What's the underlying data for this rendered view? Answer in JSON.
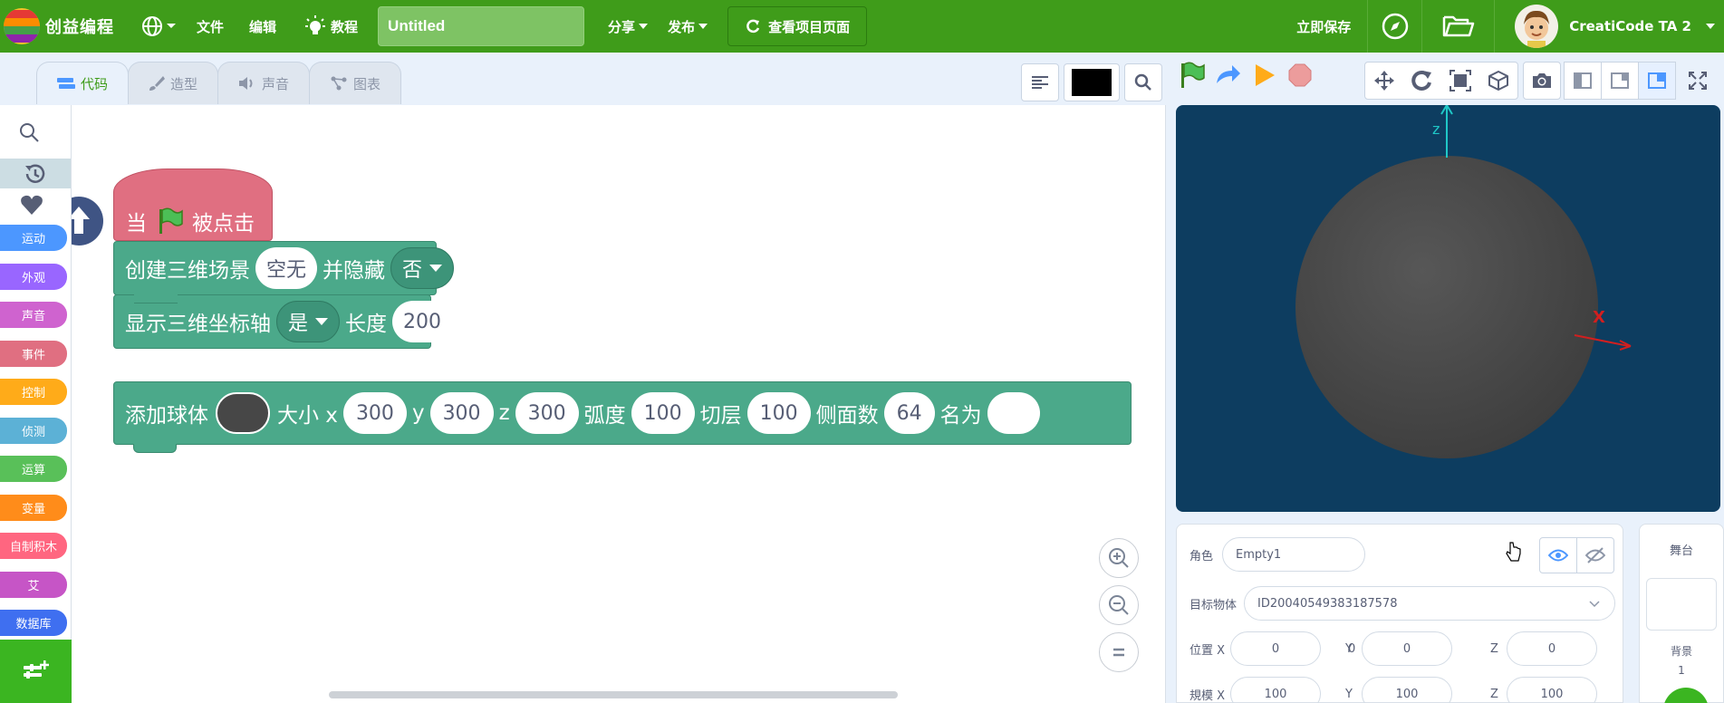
{
  "menubar": {
    "logo_text": "创益编程",
    "file": "文件",
    "edit": "编辑",
    "tutorial": "教程",
    "project_title": "Untitled",
    "share": "分享",
    "publish": "发布",
    "view_project_page": "查看项目页面",
    "save_now": "立即保存",
    "username": "CreatiCode TA 2"
  },
  "tabs": {
    "code": "代码",
    "costumes": "造型",
    "sounds": "声音",
    "charts": "图表"
  },
  "categories": [
    {
      "label": "运动",
      "color": "#4c97ff"
    },
    {
      "label": "外观",
      "color": "#9966ff"
    },
    {
      "label": "声音",
      "color": "#cf63cf"
    },
    {
      "label": "事件",
      "color": "#e06f81"
    },
    {
      "label": "控制",
      "color": "#ffab19"
    },
    {
      "label": "侦测",
      "color": "#5cb1d6"
    },
    {
      "label": "运算",
      "color": "#59c059"
    },
    {
      "label": "变量",
      "color": "#ff8c1a"
    },
    {
      "label": "自制积木",
      "color": "#ff6680"
    },
    {
      "label": "艾",
      "color": "#c655c6"
    },
    {
      "label": "数据库",
      "color": "#3f6ff0"
    }
  ],
  "blocks": {
    "hat": {
      "when": "当",
      "clicked": "被点击"
    },
    "create_scene": {
      "label": "创建三维场景",
      "scene": "空无",
      "and_hide": "并隐藏",
      "hide": "否"
    },
    "show_axis": {
      "label": "显示三维坐标轴",
      "value": "是",
      "length_label": "长度",
      "length": "200"
    },
    "add_sphere": {
      "label": "添加球体",
      "size_x_label": "大小 x",
      "x": "300",
      "y_label": "y",
      "y": "300",
      "z_label": "z",
      "z": "300",
      "arc_label": "弧度",
      "arc": "100",
      "slice_label": "切层",
      "slice": "100",
      "sides_label": "侧面数",
      "sides": "64",
      "name_label": "名为",
      "name": ""
    }
  },
  "stage": {
    "background": "#0d3d60",
    "axis_z": "z",
    "axis_x": "X",
    "sphere_color": "#474747"
  },
  "sprite_panel": {
    "sprite_label": "角色",
    "sprite_name": "Empty1",
    "target_label": "目标物体",
    "target_value": "ID20040549383187578",
    "position_x_label": "位置 X",
    "position_x": "0",
    "position_y_label": "Y",
    "position_y": "0",
    "position_z_label": "Z",
    "position_z": "0",
    "scale_x_label": "規模 X",
    "scale_x": "100",
    "scale_y_label": "Y",
    "scale_y": "100",
    "scale_z_label": "Z",
    "scale_z": "100"
  },
  "stage_panel": {
    "title": "舞台",
    "backdrop_label": "背景",
    "backdrop_count": "1"
  }
}
